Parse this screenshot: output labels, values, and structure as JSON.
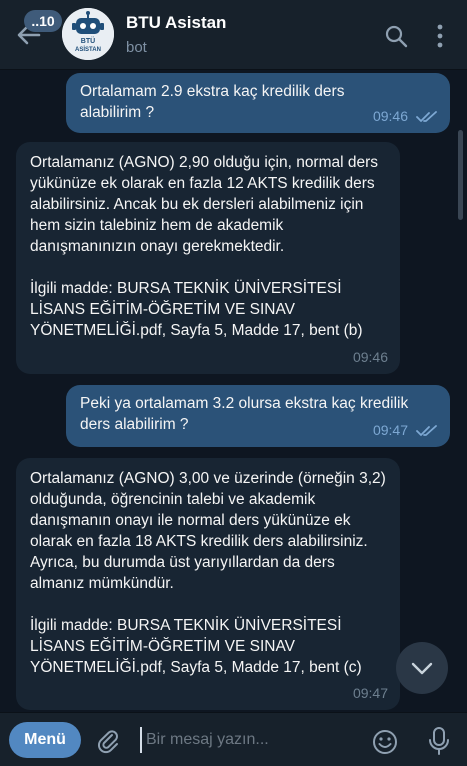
{
  "header": {
    "unread_count": "..10",
    "title": "BTU Asistan",
    "subtitle": "bot",
    "avatar_text": "BTÜ ASİSTAN"
  },
  "messages": [
    {
      "direction": "outgoing",
      "text": "Ortalamam 2.9 ekstra kaç kredilik ders alabilirim ?",
      "time": "09:46",
      "status": "read"
    },
    {
      "direction": "incoming",
      "text": "Ortalamanız (AGNO) 2,90 olduğu için, normal ders yükünüze ek olarak en fazla 12 AKTS kredilik ders alabilirsiniz. Ancak bu ek dersleri alabilmeniz için hem sizin talebiniz hem de akademik danışmanınızın onayı gerekmektedir.\n\nİlgili madde: BURSA TEKNİK ÜNİVERSİTESİ LİSANS EĞİTİM-ÖĞRETİM VE SINAV YÖNETMELİĞİ.pdf, Sayfa 5, Madde 17, bent (b)",
      "time": "09:46"
    },
    {
      "direction": "outgoing",
      "text": "Peki ya ortalamam 3.2 olursa ekstra kaç kredilik ders alabilirim ?",
      "time": "09:47",
      "status": "read"
    },
    {
      "direction": "incoming",
      "text": "Ortalamanız (AGNO) 3,00 ve üzerinde (örneğin 3,2) olduğunda, öğrencinin talebi ve akademik danışmanın onayı ile normal ders yükünüze ek olarak en fazla 18 AKTS kredilik ders alabilirsiniz. Ayrıca, bu durumda üst yarıyıllardan da ders almanız mümkündür.\n\nİlgili madde: BURSA TEKNİK ÜNİVERSİTESİ LİSANS EĞİTİM-ÖĞRETİM VE SINAV YÖNETMELİĞİ.pdf, Sayfa 5, Madde 17, bent (c)",
      "time": "09:47"
    }
  ],
  "input": {
    "menu_label": "Menü",
    "placeholder": "Bir mesaj yazın..."
  },
  "icons": {
    "back": "arrow-left-icon",
    "search": "search-icon",
    "menu": "vertical-dots-icon",
    "attach": "paperclip-icon",
    "emoji": "smiley-icon",
    "mic": "microphone-icon",
    "scroll_down": "chevron-down-icon",
    "read_status": "double-check-icon"
  },
  "colors": {
    "background": "#0e1621",
    "header": "#17212b",
    "outgoing_bubble": "#2b5278",
    "incoming_bubble": "#182533",
    "accent": "#5288c1"
  }
}
